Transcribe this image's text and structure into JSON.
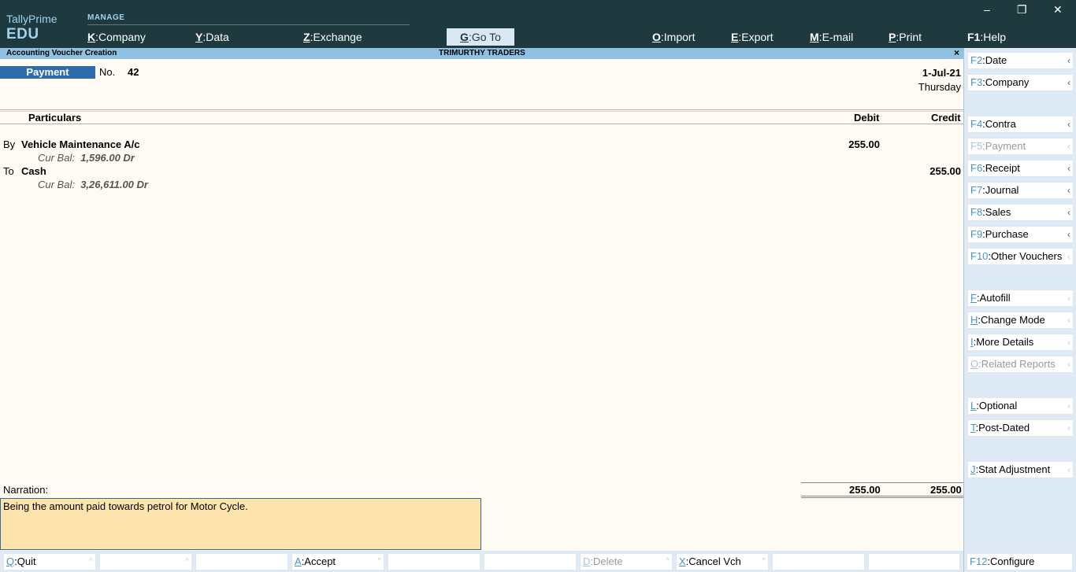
{
  "app": {
    "brand_line1": "TallyPrime",
    "brand_line2": "EDU",
    "menu_group": "MANAGE"
  },
  "menu": [
    {
      "key": "K",
      "sep": ":",
      "label": "Company"
    },
    {
      "key": "Y",
      "sep": ":",
      "label": "Data"
    },
    {
      "key": "Z",
      "sep": ":",
      "label": "Exchange"
    },
    {
      "key": "G",
      "sep": ":",
      "label": "Go To"
    },
    {
      "key": "O",
      "sep": ":",
      "label": "Import"
    },
    {
      "key": "E",
      "sep": ":",
      "label": "Export"
    },
    {
      "key": "M",
      "sep": ":",
      "label": "E-mail"
    },
    {
      "key": "P",
      "sep": ":",
      "label": "Print"
    },
    {
      "key": "F1",
      "sep": ":",
      "label": "Help"
    }
  ],
  "window_controls": {
    "minimize": "–",
    "restore": "❐",
    "close": "✕"
  },
  "screen": {
    "title": "Accounting Voucher Creation",
    "company": "TRIMURTHY TRADERS",
    "close": "×"
  },
  "voucher": {
    "type": "Payment",
    "no_label": "No.",
    "number": "42",
    "date": "1-Jul-21",
    "day": "Thursday",
    "columns": {
      "particulars": "Particulars",
      "debit": "Debit",
      "credit": "Credit"
    },
    "entries": [
      {
        "prefix": "By",
        "ledger": "Vehicle Maintenance A/c",
        "balance_label": "Cur Bal:",
        "balance": "1,596.00 Dr",
        "debit": "255.00",
        "credit": ""
      },
      {
        "prefix": "To",
        "ledger": "Cash",
        "balance_label": "Cur Bal:",
        "balance": "3,26,611.00 Dr",
        "debit": "",
        "credit": "255.00"
      }
    ],
    "narration_label": "Narration:",
    "narration": "Being the amount paid towards petrol for Motor Cycle.",
    "total_debit": "255.00",
    "total_credit": "255.00"
  },
  "right_panel": [
    {
      "key": "F2",
      "label": "Date",
      "disabled": false,
      "arrow": "‹"
    },
    {
      "key": "F3",
      "label": "Company",
      "disabled": false,
      "arrow": "‹"
    },
    {
      "key": "F4",
      "label": "Contra",
      "disabled": false,
      "arrow": "‹"
    },
    {
      "key": "F5",
      "label": "Payment",
      "disabled": true,
      "arrow": "‹"
    },
    {
      "key": "F6",
      "label": "Receipt",
      "disabled": false,
      "arrow": "‹"
    },
    {
      "key": "F7",
      "label": "Journal",
      "disabled": false,
      "arrow": "‹"
    },
    {
      "key": "F8",
      "label": "Sales",
      "disabled": false,
      "arrow": "‹"
    },
    {
      "key": "F9",
      "label": "Purchase",
      "disabled": false,
      "arrow": "‹"
    },
    {
      "key": "F10",
      "label": "Other Vouchers",
      "disabled": false,
      "arrow": "‹"
    },
    {
      "key": "F",
      "label": "Autofill",
      "disabled": false,
      "arrow": "‹"
    },
    {
      "key": "H",
      "label": "Change Mode",
      "disabled": false,
      "arrow": "‹"
    },
    {
      "key": "I",
      "label": "More Details",
      "disabled": false,
      "arrow": "‹"
    },
    {
      "key": "O",
      "label": "Related Reports",
      "disabled": true,
      "arrow": "‹"
    },
    {
      "key": "L",
      "label": "Optional",
      "disabled": false,
      "arrow": "‹"
    },
    {
      "key": "T",
      "label": "Post-Dated",
      "disabled": false,
      "arrow": "‹"
    },
    {
      "key": "J",
      "label": "Stat Adjustment",
      "disabled": false,
      "arrow": "‹"
    }
  ],
  "bottom_bar": [
    {
      "key": "Q",
      "label": "Quit",
      "disabled": false
    },
    {
      "key": "",
      "label": "",
      "disabled": false
    },
    {
      "key": "",
      "label": "",
      "disabled": false
    },
    {
      "key": "A",
      "label": "Accept",
      "disabled": false
    },
    {
      "key": "",
      "label": "",
      "disabled": false
    },
    {
      "key": "",
      "label": "",
      "disabled": false
    },
    {
      "key": "D",
      "label": "Delete",
      "disabled": true
    },
    {
      "key": "X",
      "label": "Cancel Vch",
      "disabled": false
    },
    {
      "key": "",
      "label": "",
      "disabled": false
    },
    {
      "key": "",
      "label": "",
      "disabled": false
    },
    {
      "key": "F12",
      "label": "Configure",
      "disabled": false
    }
  ],
  "small_arrow": "^",
  "colors": {
    "topbar": "#1f3a3f",
    "accent": "#2f6ba8",
    "title_strip": "#8fc1e3",
    "narration_bg": "#fde4ad",
    "panel_bg": "#deebf6"
  }
}
